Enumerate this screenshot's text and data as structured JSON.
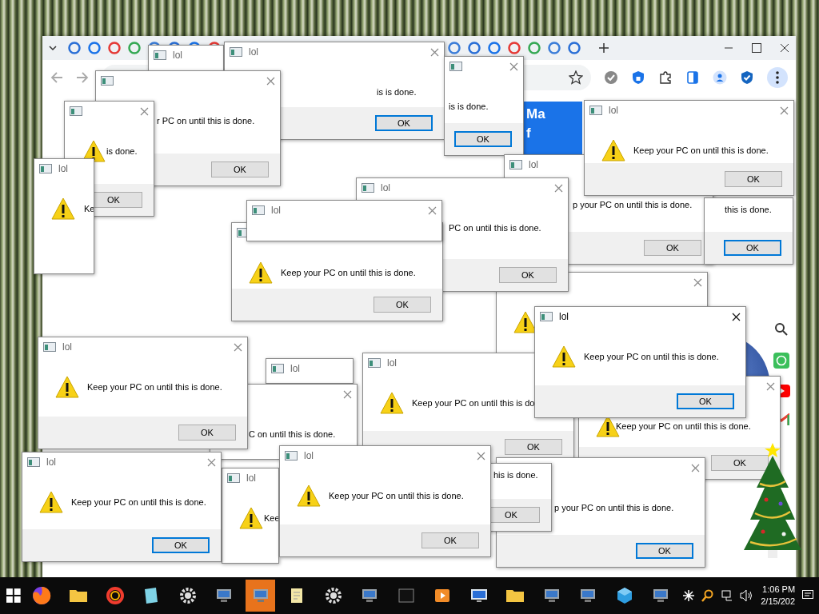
{
  "browser": {
    "card_lines": [
      "Ma",
      "f"
    ]
  },
  "dialogs": [
    {
      "title": "lol",
      "active": false
    },
    {
      "title": "lol",
      "message": "is is done.",
      "button": "OK",
      "focused": true,
      "active": false
    },
    {
      "message": "is is done.",
      "button": "OK",
      "focused": true,
      "active": false
    },
    {
      "message": "r PC on until this is done.",
      "button": "OK",
      "focused": false
    },
    {
      "message": "is done.",
      "button": "OK",
      "focused": false,
      "active": false
    },
    {
      "title": "lol",
      "message": "Keep your PC on until this is done.",
      "button": "OK",
      "focused": false,
      "active": false
    },
    {
      "title": "lol",
      "message": "Ke",
      "active": false
    },
    {
      "title": "lol",
      "message": "p your PC on until this is done.",
      "button": "OK",
      "focused": false,
      "active": false
    },
    {
      "title": "lol",
      "message": "PC on until this is done.",
      "button": "OK",
      "focused": false,
      "active": false
    },
    {
      "title": "lol",
      "active": false
    },
    {
      "message": "this is done.",
      "button": "OK",
      "focused": true
    },
    {
      "message": "Keep your PC on until this is done.",
      "button": "OK",
      "focused": false
    },
    {
      "active": false
    },
    {
      "title": "lol",
      "message": "Keep your PC on until this is done.",
      "button": "OK",
      "focused": true,
      "active": true
    },
    {
      "title": "lol",
      "message": "Keep your PC on until this is done.",
      "button": "OK",
      "focused": false,
      "active": false
    },
    {
      "title": "lol",
      "active": false
    },
    {
      "title": "lol",
      "message": "Keep your PC on until this is do",
      "button": "OK",
      "focused": false,
      "active": false
    },
    {
      "message": "C on until this is done.",
      "active": false
    },
    {
      "message": "Keep your PC on until this is done.",
      "button": "OK",
      "focused": false,
      "active": false
    },
    {
      "title": "lol",
      "message": "Keep your PC on until this is done.",
      "button": "OK",
      "focused": true,
      "active": false
    },
    {
      "title": "lol",
      "message": "Kee",
      "active": false
    },
    {
      "title": "lol",
      "message": "Keep your PC on until this is done.",
      "button": "OK",
      "focused": false,
      "active": false
    },
    {
      "message": "his is done.",
      "button": "OK",
      "focused": false
    },
    {
      "message": "p your PC on until this is done.",
      "button": "OK",
      "focused": true,
      "active": false
    }
  ],
  "taskbar": {
    "apps": [
      {
        "kind": "firefox",
        "selected": false
      },
      {
        "kind": "folder",
        "selected": false
      },
      {
        "kind": "ring",
        "selected": false
      },
      {
        "kind": "notepad",
        "selected": false
      },
      {
        "kind": "gear",
        "selected": false
      },
      {
        "kind": "computer",
        "selected": false
      },
      {
        "kind": "computer",
        "selected": true
      },
      {
        "kind": "doc",
        "selected": false
      },
      {
        "kind": "gear",
        "selected": false
      },
      {
        "kind": "computer",
        "selected": false
      },
      {
        "kind": "square",
        "selected": false
      },
      {
        "kind": "media",
        "selected": false
      },
      {
        "kind": "monitor",
        "selected": false
      },
      {
        "kind": "folder",
        "selected": false
      },
      {
        "kind": "computer",
        "selected": false
      },
      {
        "kind": "computer",
        "selected": false
      },
      {
        "kind": "cube",
        "selected": false
      },
      {
        "kind": "computer",
        "selected": false
      }
    ],
    "time": "1:06 PM",
    "date": "2/15/202"
  }
}
